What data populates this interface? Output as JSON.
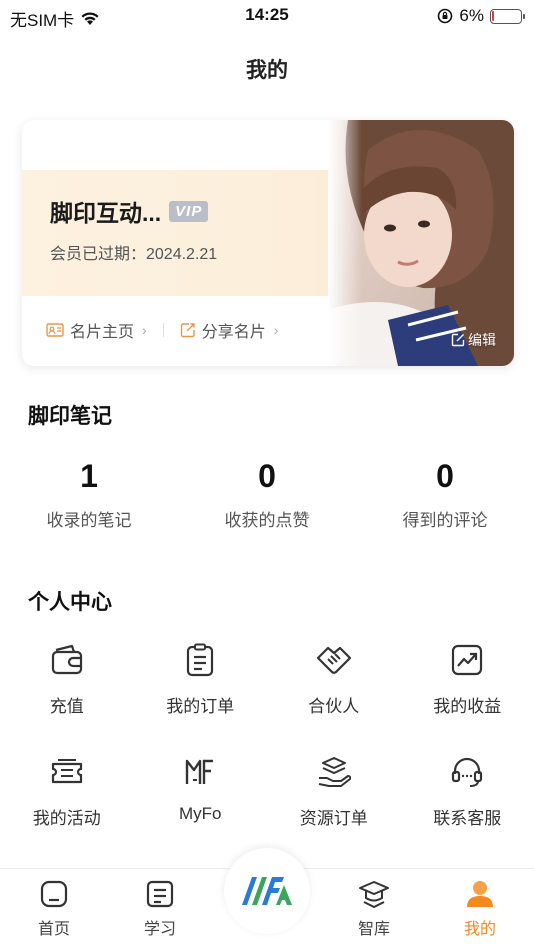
{
  "status_bar": {
    "carrier": "无SIM卡",
    "time": "14:25",
    "battery_text": "6%",
    "battery_level": 0.06
  },
  "header": {
    "title": "我的"
  },
  "profile_card": {
    "name": "脚印互动...",
    "vip_label": "VIP",
    "expire_text": "会员已过期：2024.2.21",
    "link_homepage": "名片主页",
    "link_share": "分享名片",
    "edit_label": "编辑"
  },
  "notes": {
    "title": "脚印笔记",
    "stats": [
      {
        "value": "1",
        "label": "收录的笔记"
      },
      {
        "value": "0",
        "label": "收获的点赞"
      },
      {
        "value": "0",
        "label": "得到的评论"
      }
    ]
  },
  "personal_center": {
    "title": "个人中心",
    "items": [
      {
        "label": "充值",
        "icon": "wallet-icon"
      },
      {
        "label": "我的订单",
        "icon": "clipboard-icon"
      },
      {
        "label": "合伙人",
        "icon": "handshake-icon"
      },
      {
        "label": "我的收益",
        "icon": "chart-up-icon"
      },
      {
        "label": "我的活动",
        "icon": "ticket-icon"
      },
      {
        "label": "MyFo",
        "icon": "myfo-icon"
      },
      {
        "label": "资源订单",
        "icon": "stack-hand-icon"
      },
      {
        "label": "联系客服",
        "icon": "headset-icon"
      }
    ]
  },
  "tabbar": {
    "tabs": [
      {
        "label": "首页",
        "icon": "home-icon"
      },
      {
        "label": "学习",
        "icon": "document-icon"
      },
      {
        "label": "智库",
        "icon": "graduation-cap-icon"
      },
      {
        "label": "我的",
        "icon": "person-icon",
        "active": true
      }
    ],
    "center_icon": "app-logo-icon"
  },
  "colors": {
    "accent": "#f28a1e",
    "card_band": "#fdf1e0",
    "vip_badge": "#b9bec8",
    "battery_low": "#e53935"
  }
}
